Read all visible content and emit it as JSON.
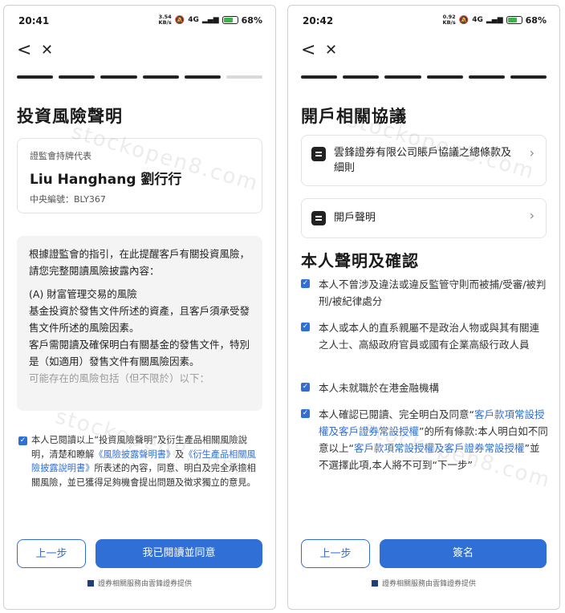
{
  "left": {
    "status": {
      "time": "20:41",
      "speed": "3.54",
      "speed_unit": "KB/s",
      "network": "4G",
      "battery": "68",
      "battery_unit": "%"
    },
    "nav": {
      "back": "<",
      "close": "✕"
    },
    "progress": {
      "total": 6,
      "completed": 5
    },
    "title": "投資風險聲明",
    "rep": {
      "label": "證監會持牌代表",
      "name": "Liu Hanghang 劉行行",
      "code": "中央編號：BLY367"
    },
    "disclosure": {
      "p1": "根據證監會的指引，在此提醒客戶有關投資風險，請您完整閱讀風險披露內容：",
      "p2_head": "(A) 財富管理交易的風險",
      "p2_body": "基金投資於發售文件所述的資產，且客戶須承受發售文件所述的風險因素。",
      "p3": "客戶需閱讀及確保明白有關基金的發售文件，特別是（如適用）發售文件有關風險因素。",
      "p4": "可能存在的風險包括（但不限於）以下："
    },
    "consent": {
      "pre": "本人已閱讀以上“投資風險聲明”及衍生產品相關風險說明，清楚和瞭解",
      "link1": "《風險披露聲明書》",
      "mid": "及",
      "link2": "《衍生產品相關風險披露說明書》",
      "post": "所表述的內容，同意、明白及完全承擔相關風險，並已獲得足夠機會提出問題及徵求獨立的意見。"
    },
    "buttons": {
      "prev": "上一步",
      "agree": "我已閱讀並同意"
    },
    "footer": "證券相關服務由雲鋒證券提供",
    "watermark": "stockopen8.com"
  },
  "right": {
    "status": {
      "time": "20:42",
      "speed": "0.92",
      "speed_unit": "KB/s",
      "network": "4G",
      "battery": "68",
      "battery_unit": "%"
    },
    "nav": {
      "back": "<",
      "close": "✕"
    },
    "progress": {
      "total": 6,
      "completed": 6
    },
    "title": "開戶相關協議",
    "docs": [
      {
        "label": "雲鋒證券有限公司賬戶協議之總條款及細則"
      },
      {
        "label": "開戶聲明"
      }
    ],
    "section_title": "本人聲明及確認",
    "checks": [
      {
        "text": "本人不曾涉及違法或違反監管守則而被捕/受審/被判刑/被紀律處分"
      },
      {
        "text": "本人或本人的直系親屬不是政治人物或與其有關連之人士、高級政府官員或國有企業高級行政人員"
      },
      {
        "text": "本人未就職於在港金融機構"
      }
    ],
    "last_check": {
      "pre": "本人確認已閱讀、完全明白及同意“",
      "link1": "客戶款項常設授權及客戶證券常設授權",
      "mid": "”的所有條款:本人明白如不同意以上“",
      "link2": "客戶款項常設授權及客戶證券常設授權",
      "post": "”並不選擇此項,本人將不可到“下一步”"
    },
    "buttons": {
      "prev": "上一步",
      "sign": "簽名"
    },
    "footer": "證券相關服務由雲鋒證券提供",
    "watermark": "stockopen8.com"
  },
  "colors": {
    "accent": "#2f6fd6",
    "check": "#2f6fd6",
    "progress_done": "#222222",
    "progress_todo": "#d9d9d9"
  }
}
